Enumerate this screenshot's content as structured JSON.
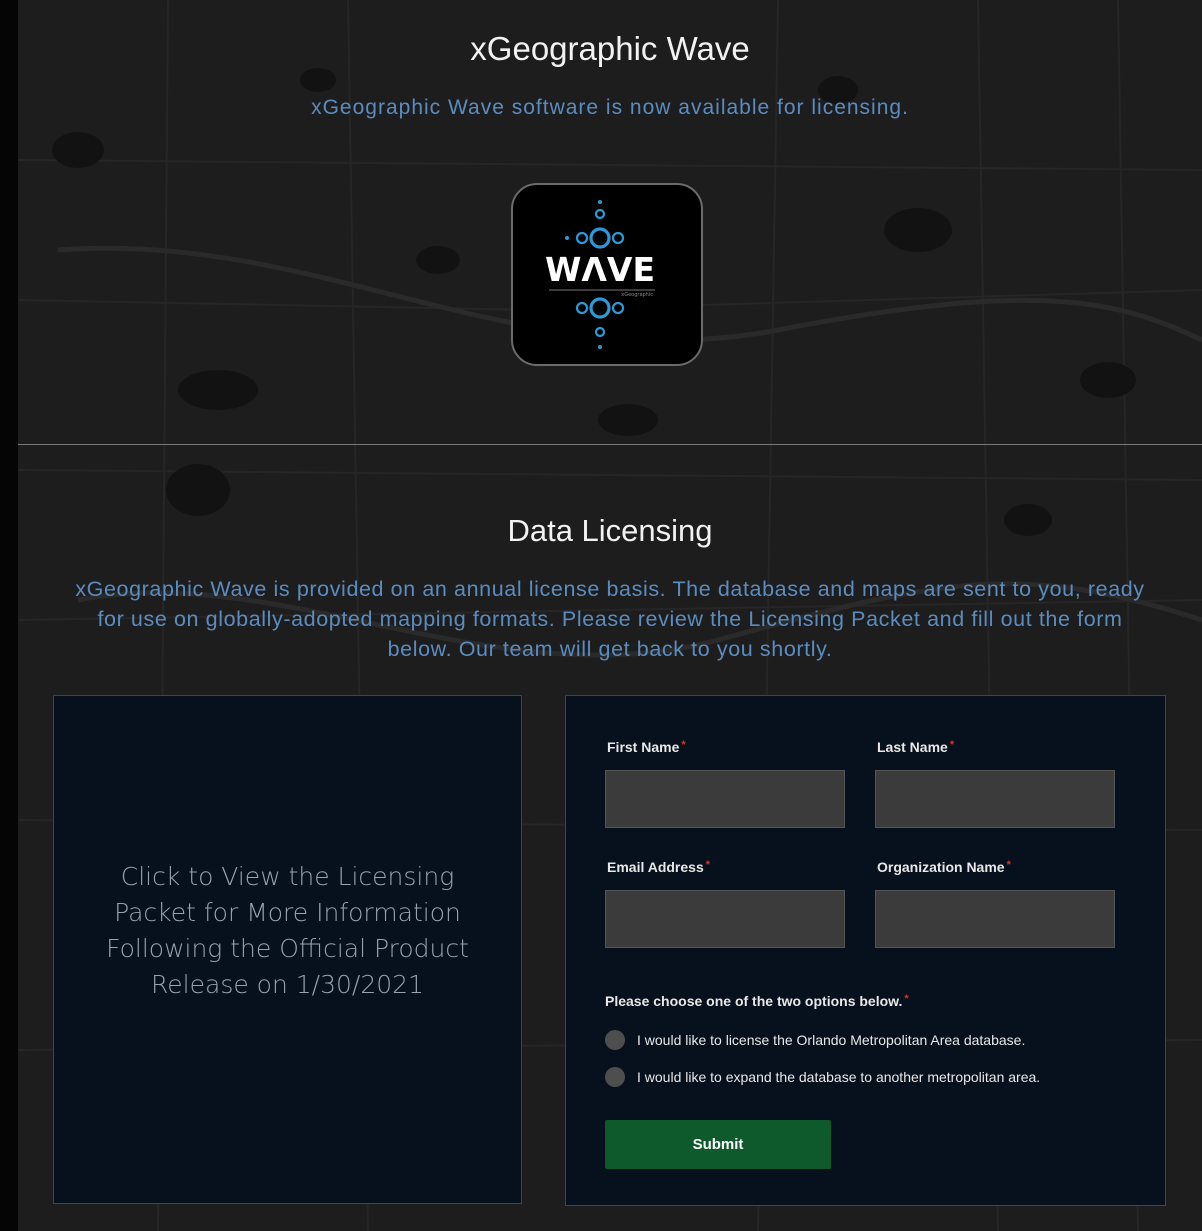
{
  "header": {
    "title": "xGeographic Wave",
    "subtitle": "xGeographic Wave software is now available for licensing."
  },
  "logo": {
    "wordmark": "WΛVE",
    "tagline": "xGeographic",
    "accent_color": "#2b9ad6"
  },
  "section": {
    "title": "Data Licensing",
    "description": "xGeographic Wave is provided on an annual license basis. The database and maps are sent to you, ready for use on globally-adopted mapping formats. Please review the Licensing Packet and fill out the form below. Our team will get back to you shortly."
  },
  "packet": {
    "text": "Click to View the Licensing Packet for More Information Following the Official Product Release on 1/30/2021"
  },
  "form": {
    "first_name_label": "First Name",
    "last_name_label": "Last Name",
    "email_label": "Email Address",
    "org_label": "Organization Name",
    "required_marker": "*",
    "first_name_value": "",
    "last_name_value": "",
    "email_value": "",
    "org_value": "",
    "question": "Please choose one of the two options below.",
    "options": [
      "I would like to license the Orlando Metropolitan Area database.",
      "I would like to expand the database to another metropolitan area."
    ],
    "submit_label": "Submit"
  },
  "colors": {
    "background": "#181818",
    "accent_text": "#5b8cc0",
    "panel": "#07111d",
    "submit": "#0f5a2c",
    "required": "#d9342b"
  }
}
